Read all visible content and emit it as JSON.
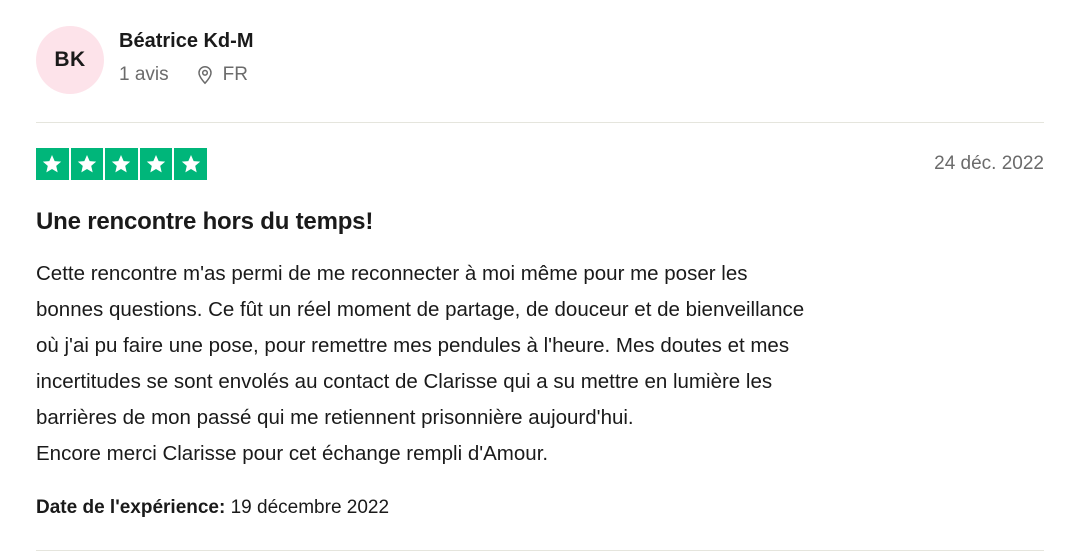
{
  "consumer": {
    "initials": "BK",
    "name": "Béatrice Kd-M",
    "reviews_count": "1 avis",
    "country": "FR",
    "avatar_color": "#fde3ea"
  },
  "review": {
    "rating": 5,
    "max_rating": 5,
    "star_color": "#00b67a",
    "date": "24 déc. 2022",
    "title": "Une rencontre hors du temps!",
    "body_lines": [
      "Cette rencontre m'as permi de me reconnecter à moi même pour me poser les",
      "bonnes questions. Ce fût un réel moment de partage, de douceur et de bienveillance",
      "où j'ai pu faire une pose, pour remettre mes pendules à l'heure. Mes doutes et mes",
      "incertitudes se sont envolés au contact de Clarisse qui a su mettre en lumière les",
      "barrières de mon passé qui me retiennent prisonnière aujourd'hui.",
      "Encore merci Clarisse pour cet échange rempli d'Amour."
    ],
    "experience_label": "Date de l'expérience:",
    "experience_date": "19 décembre 2022"
  },
  "icons": {
    "location": "location-pin-icon",
    "star": "star-icon"
  }
}
